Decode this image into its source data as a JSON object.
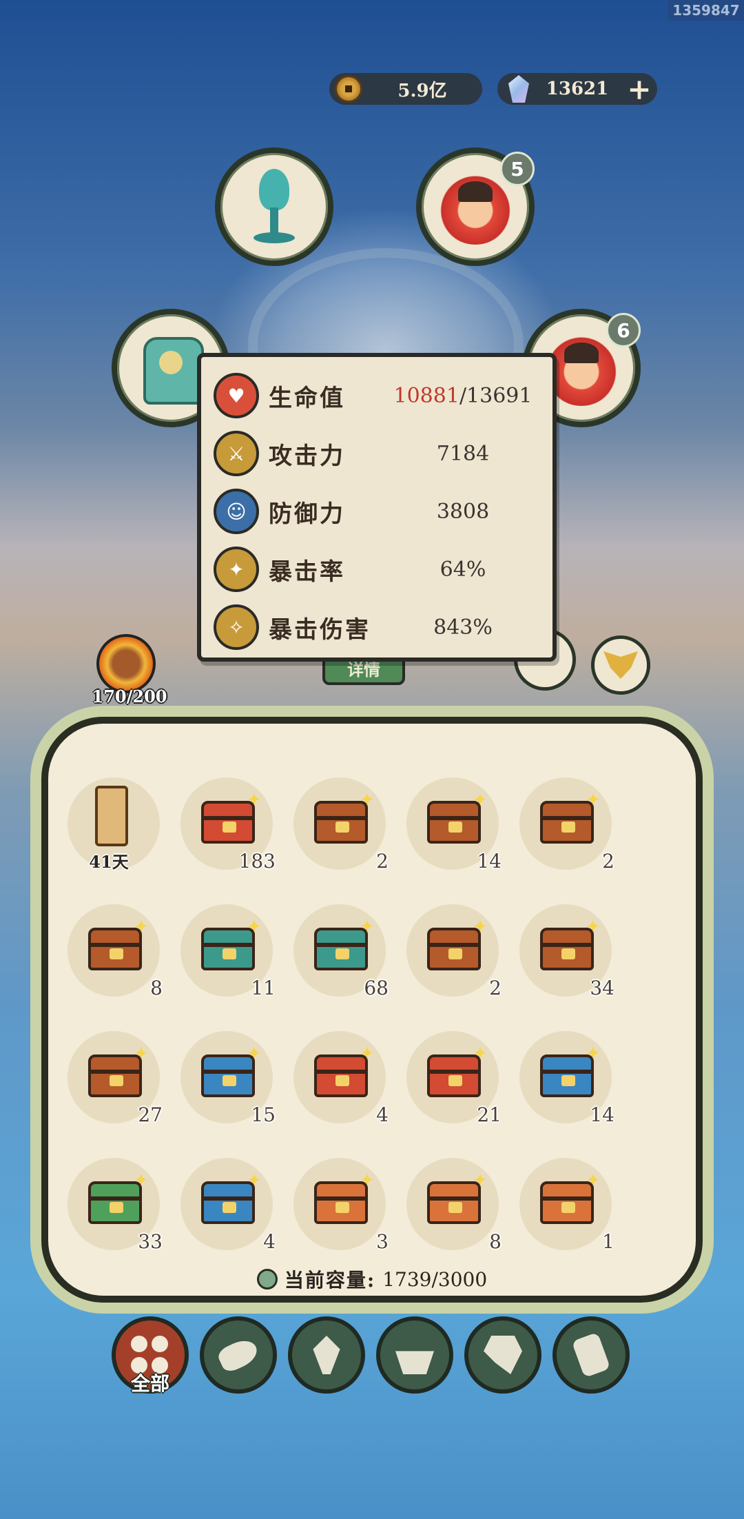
{
  "corner_id": "1359847",
  "currency": {
    "coins": "5.9亿",
    "gems": "13621",
    "add_label": "+"
  },
  "slots": {
    "top_right_badge": "5",
    "right_badge": "6"
  },
  "hero": {
    "level": "170/200"
  },
  "stats": [
    {
      "label": "生命值",
      "value": "/13691",
      "current": "10881",
      "icon": "heart-icon",
      "color": "#d9503a"
    },
    {
      "label": "攻击力",
      "value": "7184",
      "icon": "sword-icon",
      "color": "#c79a3a"
    },
    {
      "label": "防御力",
      "value": "3808",
      "icon": "person-icon",
      "color": "#3c6fa8"
    },
    {
      "label": "暴击率",
      "value": "64%",
      "icon": "crit-rate-icon",
      "color": "#c79a3a"
    },
    {
      "label": "暴击伤害",
      "value": "843%",
      "icon": "crit-damage-icon",
      "color": "#c79a3a"
    }
  ],
  "detail_tab": "详情",
  "items": [
    {
      "type": "scroll",
      "days": "41天"
    },
    {
      "type": "chest",
      "color": "red",
      "count": "183"
    },
    {
      "type": "chest",
      "color": "brown",
      "count": "2"
    },
    {
      "type": "chest",
      "color": "brown",
      "count": "14"
    },
    {
      "type": "chest",
      "color": "brown",
      "count": "2"
    },
    {
      "type": "chest",
      "color": "brown",
      "count": "8"
    },
    {
      "type": "chest",
      "color": "teal",
      "count": "11"
    },
    {
      "type": "chest",
      "color": "teal",
      "count": "68"
    },
    {
      "type": "chest",
      "color": "brown",
      "count": "2"
    },
    {
      "type": "chest",
      "color": "brown",
      "count": "34"
    },
    {
      "type": "chest",
      "color": "brown",
      "count": "27"
    },
    {
      "type": "chest",
      "color": "blue",
      "count": "15"
    },
    {
      "type": "chest",
      "color": "red",
      "count": "4"
    },
    {
      "type": "chest",
      "color": "red",
      "count": "21"
    },
    {
      "type": "chest",
      "color": "blue",
      "count": "14"
    },
    {
      "type": "chest",
      "color": "green",
      "count": "33"
    },
    {
      "type": "chest",
      "color": "blue",
      "count": "4"
    },
    {
      "type": "chest",
      "color": "orange",
      "count": "3"
    },
    {
      "type": "chest",
      "color": "orange",
      "count": "8"
    },
    {
      "type": "chest",
      "color": "orange",
      "count": "1"
    }
  ],
  "capacity": {
    "label": "当前容量:",
    "value": "1739/3000"
  },
  "filters": [
    {
      "label": "全部",
      "icon": "all-icon",
      "active": true
    },
    {
      "label": "",
      "icon": "wood-icon",
      "active": false
    },
    {
      "label": "",
      "icon": "leaf-icon",
      "active": false
    },
    {
      "label": "",
      "icon": "bowl-icon",
      "active": false
    },
    {
      "label": "",
      "icon": "cloth-icon",
      "active": false
    },
    {
      "label": "",
      "icon": "scroll-icon",
      "active": false
    }
  ]
}
